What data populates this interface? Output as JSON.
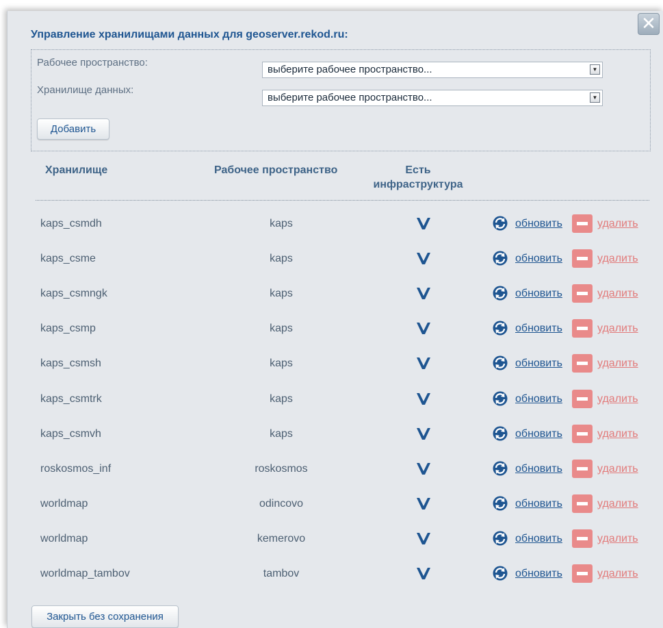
{
  "dialog": {
    "title": "Управление хранилищами данных для geoserver.rekod.ru:",
    "close_icon": "close-icon"
  },
  "form": {
    "workspace_label": "Рабочее пространство:",
    "workspace_value": "выберите рабочее пространство...",
    "datastore_label": "Хранилище данных:",
    "datastore_value": "выберите рабочее пространство...",
    "add_button": "Добавить"
  },
  "table": {
    "headers": {
      "store": "Хранилище",
      "workspace": "Рабочее пространство",
      "infra_line1": "Есть",
      "infra_line2": "инфраструктура"
    },
    "refresh_label": "обновить",
    "delete_label": "удалить",
    "icons": {
      "check": "check-icon",
      "refresh": "refresh-icon",
      "delete": "delete-icon"
    },
    "rows": [
      {
        "store": "kaps_csmdh",
        "workspace": "kaps",
        "has_infrastructure": true
      },
      {
        "store": "kaps_csme",
        "workspace": "kaps",
        "has_infrastructure": true
      },
      {
        "store": "kaps_csmngk",
        "workspace": "kaps",
        "has_infrastructure": true
      },
      {
        "store": "kaps_csmp",
        "workspace": "kaps",
        "has_infrastructure": true
      },
      {
        "store": "kaps_csmsh",
        "workspace": "kaps",
        "has_infrastructure": true
      },
      {
        "store": "kaps_csmtrk",
        "workspace": "kaps",
        "has_infrastructure": true
      },
      {
        "store": "kaps_csmvh",
        "workspace": "kaps",
        "has_infrastructure": true
      },
      {
        "store": "roskosmos_inf",
        "workspace": "roskosmos",
        "has_infrastructure": true
      },
      {
        "store": "worldmap",
        "workspace": "odincovo",
        "has_infrastructure": true
      },
      {
        "store": "worldmap",
        "workspace": "kemerovo",
        "has_infrastructure": true
      },
      {
        "store": "worldmap_tambov",
        "workspace": "tambov",
        "has_infrastructure": true
      }
    ]
  },
  "footer": {
    "close_button": "Закрыть без сохранения"
  },
  "colors": {
    "title": "#1e5591",
    "link": "#1e5591",
    "delete": "#e98a8a",
    "background": "#e5e8ec"
  }
}
